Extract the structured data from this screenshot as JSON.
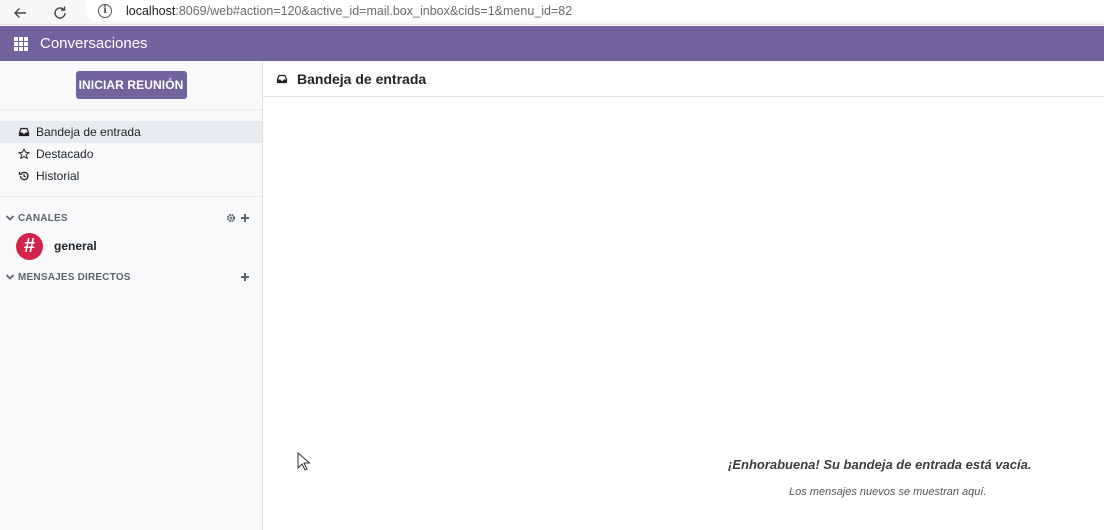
{
  "browser": {
    "url_host": "localhost",
    "url_rest": ":8069/web#action=120&active_id=mail.box_inbox&cids=1&menu_id=82"
  },
  "navbar": {
    "app_title": "Conversaciones",
    "color": "#71639e"
  },
  "sidebar": {
    "meeting_button": "INICIAR REUNIÓN",
    "mailboxes": [
      {
        "label": "Bandeja de entrada",
        "icon": "inbox-icon",
        "active": true
      },
      {
        "label": "Destacado",
        "icon": "star-icon",
        "active": false
      },
      {
        "label": "Historial",
        "icon": "history-icon",
        "active": false
      }
    ],
    "channels_header": "CANALES",
    "channels": [
      {
        "name": "general",
        "avatar": "#",
        "avatar_color": "#d2234a"
      }
    ],
    "direct_header": "MENSAJES DIRECTOS"
  },
  "main": {
    "title": "Bandeja de entrada",
    "empty_title": "¡Enhorabuena! Su bandeja de entrada está vacía.",
    "empty_subtitle": "Los mensajes nuevos se muestran aquí."
  }
}
